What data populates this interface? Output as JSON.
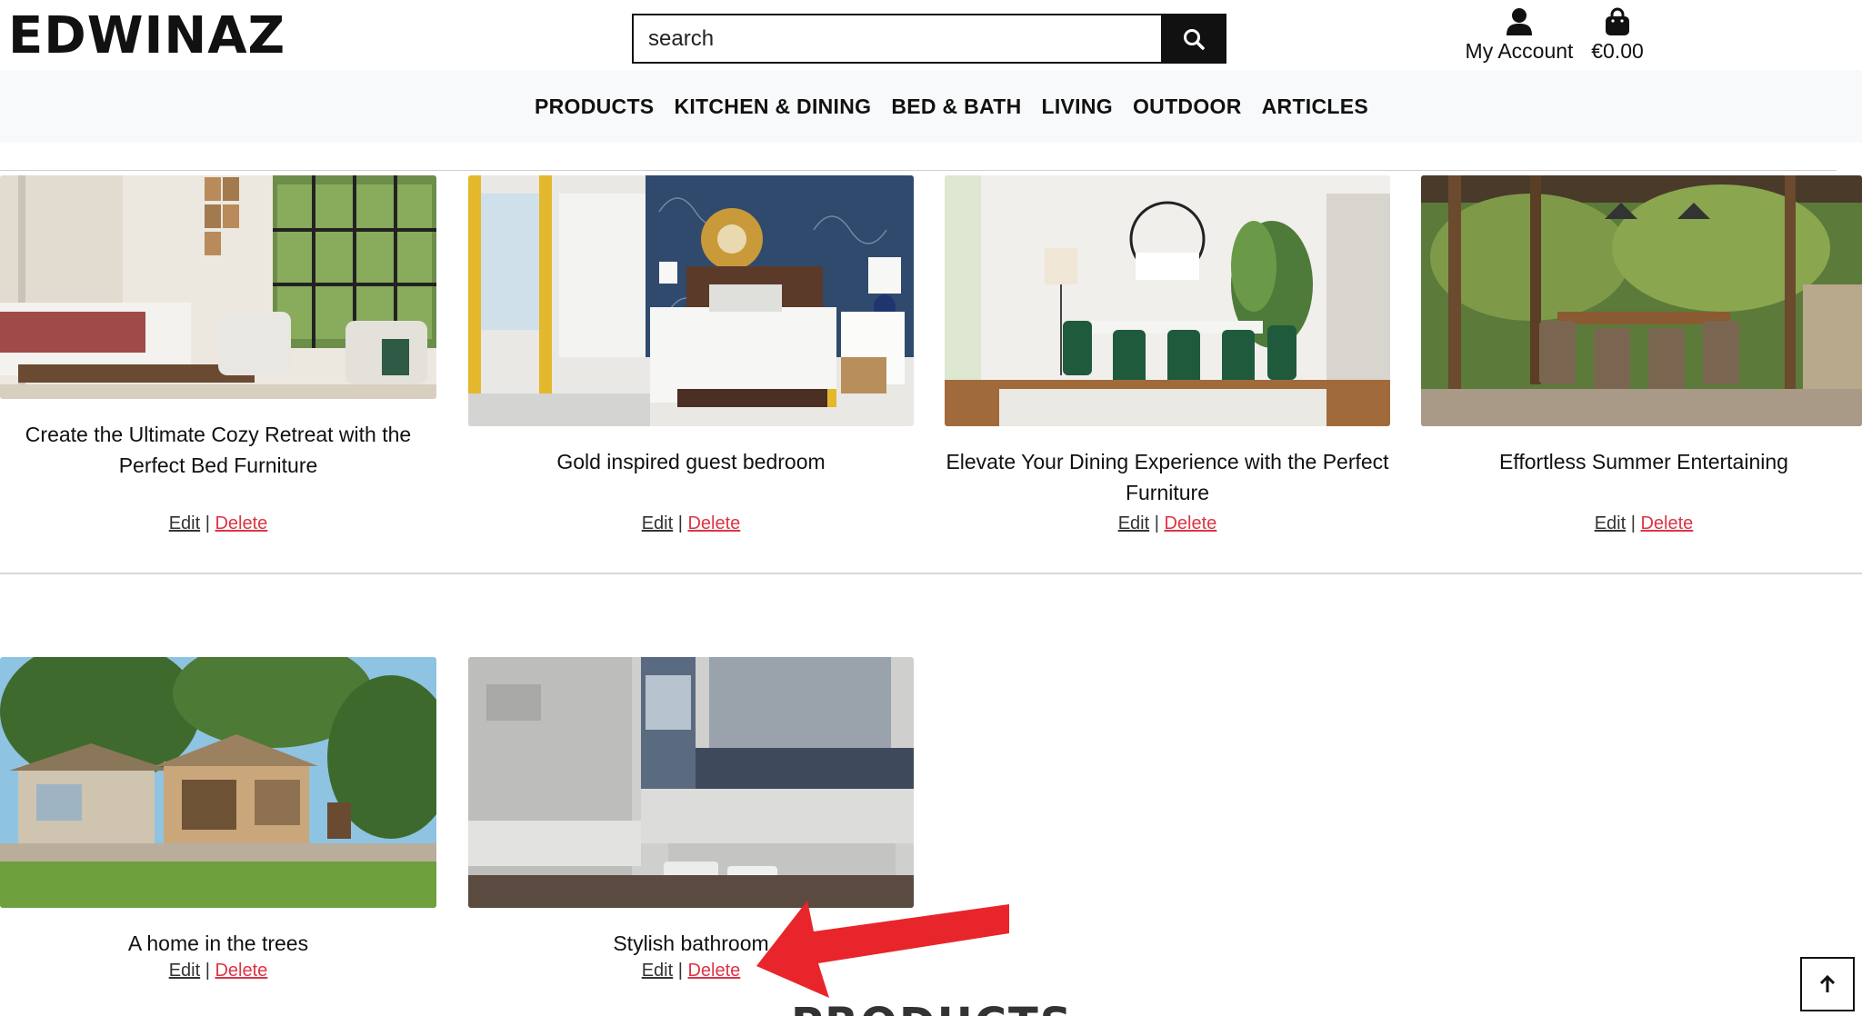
{
  "header": {
    "logo_text": "EDWINAZ",
    "search_placeholder": "search",
    "account_label": "My Account",
    "bag_total": "€0.00",
    "icons": {
      "search": "search-icon",
      "account": "user-icon",
      "bag": "shopping-bag-icon"
    }
  },
  "nav": {
    "items": [
      "PRODUCTS",
      "KITCHEN & DINING",
      "BED & BATH",
      "LIVING",
      "OUTDOOR",
      "ARTICLES"
    ]
  },
  "articles": [
    {
      "title": "Create the Ultimate Cozy Retreat with the Perfect Bed Furniture",
      "edit_label": "Edit",
      "delete_label": "Delete",
      "image": "cozy-bedroom-photo"
    },
    {
      "title": "Gold inspired guest bedroom",
      "edit_label": "Edit",
      "delete_label": "Delete",
      "image": "gold-bedroom-photo"
    },
    {
      "title": "Elevate Your Dining Experience with the Perfect Furniture",
      "edit_label": "Edit",
      "delete_label": "Delete",
      "image": "dining-room-photo"
    },
    {
      "title": "Effortless Summer Entertaining",
      "edit_label": "Edit",
      "delete_label": "Delete",
      "image": "outdoor-patio-photo"
    },
    {
      "title": "A home in the trees",
      "edit_label": "Edit",
      "delete_label": "Delete",
      "image": "garden-cabin-photo"
    },
    {
      "title": "Stylish bathroom",
      "edit_label": "Edit",
      "delete_label": "Delete",
      "image": "bathroom-photo"
    }
  ],
  "separator": "|",
  "section_heading": "PRODUCTS",
  "colors": {
    "accent_black": "#111111",
    "delete_red": "#dc3545",
    "nav_background": "#f8f9fa",
    "annotation_arrow": "#e8252b"
  },
  "back_to_top_icon": "arrow-up-icon"
}
